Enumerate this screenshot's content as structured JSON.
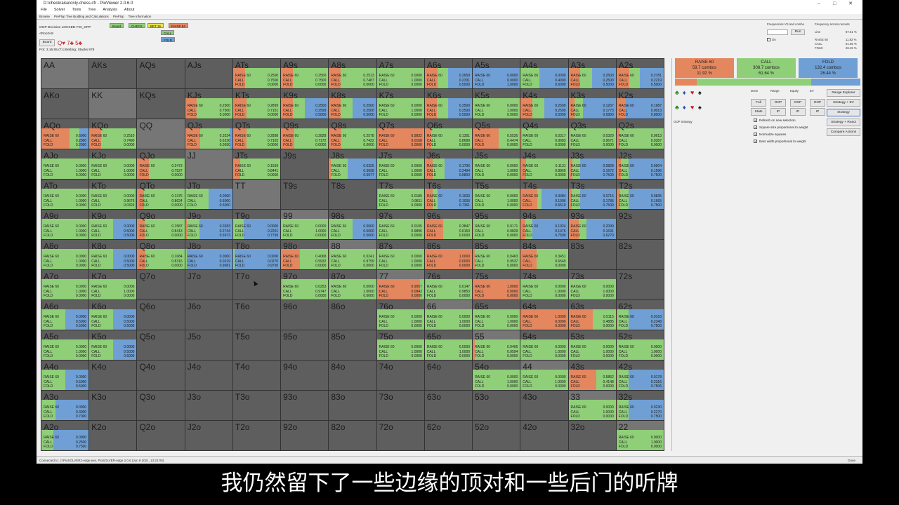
{
  "window": {
    "path": "D:\\checkraise\\only-chess.cfr - PioViewer 2.0.6.0",
    "controls": "–  □  ✕"
  },
  "menu": [
    "File",
    "Solver",
    "Tools",
    "Tree",
    "Analysis",
    "About"
  ],
  "tabs": [
    "Browse",
    "PreFlop Tree Building and Calculations",
    "PreFlop",
    "Tree Information"
  ],
  "toolbar": {
    "decision": "OOP Decision   LOCKED FIO_OPP",
    "root": "<Root>/8",
    "board_label": "Board",
    "pot_info": "Pot: 3.16.55 (7) | Betting: Stacks 978",
    "actions": [
      {
        "label": "Board",
        "color": "#8fcf78"
      },
      {
        "label": "CHECK",
        "color": "#8fcf78"
      },
      {
        "label": "BET 16",
        "color": "#e6e24a"
      },
      {
        "label": "RAISE 84",
        "color": "#e4875e"
      }
    ],
    "call_chip": "CALL",
    "fold_chip": "FOLD",
    "freq_header": "Frequencies VS and combo",
    "freq_across": "Frequency across runouts",
    "run_button": "Run",
    "line_label": "Line",
    "line_value": "87.61 %",
    "freq_rows": [
      [
        "RAISE 60",
        "11.92 %"
      ],
      [
        "CALL",
        "61.65 %"
      ],
      [
        "FOLD",
        "26.45 %"
      ]
    ],
    "on_label": "On"
  },
  "actions": [
    {
      "name": "RAISE 60",
      "combos": "59.7 combos",
      "pct": "11.92 %",
      "color": "#e4875e",
      "freq": 0.1192
    },
    {
      "name": "CALL",
      "combos": "308.7 combos",
      "pct": "61.64 %",
      "color": "#8fcf78",
      "freq": 0.6164
    },
    {
      "name": "FOLD",
      "combos": "132.4 combos",
      "pct": "26.44 %",
      "color": "#6f9fd4",
      "freq": 0.2644
    }
  ],
  "side": {
    "suits": [
      "♣",
      "♦",
      "♥",
      "♠"
    ],
    "suit_colors": [
      "#2a8a2a",
      "#2249b8",
      "#c42020",
      "#111111"
    ],
    "col_headers": [
      "Done",
      "Range",
      "Equity",
      "EV"
    ],
    "row1": [
      "Full",
      "OOP",
      "OOP",
      "OOP"
    ],
    "row2": [
      "Stats",
      "IP",
      "IP",
      "IP"
    ],
    "right_buttons": [
      "Range Explorer",
      "Strategy + EV",
      "Strategy",
      "Strategy + React",
      "Compare Actions"
    ],
    "oop_strategy": "OOP Strategy",
    "checks": [
      "Refresh on new selection",
      "Square size proportional to weight",
      "Normalize squares",
      "Bars width proportional to weight"
    ]
  },
  "status": {
    "left": "Connected to: J:\\PioSOLVER2-edge.exe, PioSOLVER-edge 2.0.6 (Jun 9 2021, 13:24:00)",
    "right": "Done"
  },
  "subtitle": "我仍然留下了一些边缘的顶对和一些后门的听牌",
  "matrix": [
    [
      "AA",
      "g",
      0,
      0,
      0
    ],
    [
      "AKs",
      "g",
      0,
      0,
      0
    ],
    [
      "AQs",
      "g",
      0,
      0,
      0
    ],
    [
      "AJs",
      "g",
      0,
      0,
      0
    ],
    [
      "ATs",
      "d",
      0.25,
      0.75,
      0
    ],
    [
      "A9s",
      "d",
      0.25,
      0.75,
      0
    ],
    [
      "A8s",
      "d",
      0.2513,
      0.7487,
      0
    ],
    [
      "A7s",
      "d",
      0,
      1,
      0
    ],
    [
      "A6s",
      "d",
      0.2659,
      0.2331,
      0.5
    ],
    [
      "A5s",
      "d",
      0,
      0,
      1
    ],
    [
      "A4s",
      "d",
      0,
      0.4,
      0.6
    ],
    [
      "A3s",
      "d",
      0.25,
      0.25,
      0.5
    ],
    [
      "A2s",
      "d",
      0.2781,
      0.2219,
      0.5
    ],
    [
      "AKo",
      "g",
      0,
      0,
      0
    ],
    [
      "KK",
      "g",
      0,
      0,
      0
    ],
    [
      "KQs",
      "g",
      0,
      0,
      0
    ],
    [
      "KJs",
      "d",
      0.25,
      0.75,
      0
    ],
    [
      "KTs",
      "d",
      0.2899,
      0.7101,
      0
    ],
    [
      "K9s",
      "d",
      0.25,
      0.2599,
      0.5
    ],
    [
      "K8s",
      "d",
      0.25,
      0.25,
      0.5
    ],
    [
      "K7s",
      "d",
      0,
      1,
      0
    ],
    [
      "K6s",
      "d",
      0.25,
      0.25,
      0.5
    ],
    [
      "K5s",
      "d",
      0,
      1,
      0
    ],
    [
      "K4s",
      "d",
      0.25,
      0.25,
      0.5
    ],
    [
      "K3s",
      "d",
      0.1267,
      0.1773,
      0.696
    ],
    [
      "K2s",
      "d",
      0.1987,
      0.0013,
      0.8
    ],
    [
      "AQo",
      "d",
      0.6,
      0.2,
      0.2
    ],
    [
      "KQo",
      "d",
      0.251,
      0.749,
      0
    ],
    [
      "QQ",
      "g",
      0,
      0,
      0
    ],
    [
      "QJs",
      "d",
      0.3224,
      0.6226,
      0.055
    ],
    [
      "QTs",
      "d",
      0.2898,
      0.7102,
      0
    ],
    [
      "Q9s",
      "d",
      0.2828,
      0.7172,
      0
    ],
    [
      "Q8s",
      "d",
      0.2578,
      0.7422,
      0
    ],
    [
      "Q7s",
      "d",
      0.9832,
      0.0168,
      0
    ],
    [
      "Q6s",
      "d",
      0.1301,
      0.8699,
      0
    ],
    [
      "Q5s",
      "d",
      0.5526,
      0.4474,
      0
    ],
    [
      "Q4s",
      "d",
      0.0317,
      0.9683,
      0
    ],
    [
      "Q3s",
      "d",
      0.0329,
      0.9671,
      0
    ],
    [
      "Q2s",
      "d",
      0.0613,
      0.9387,
      0
    ],
    [
      "AJo",
      "d",
      0,
      1,
      0
    ],
    [
      "KJo",
      "d",
      0,
      1,
      0
    ],
    [
      "QJo",
      "d",
      0.2473,
      0.7527,
      0
    ],
    [
      "JJ",
      "g",
      0,
      0,
      0
    ],
    [
      "JTs",
      "d",
      0.1559,
      0.8441,
      0
    ],
    [
      "J9s",
      "g",
      0,
      0,
      0
    ],
    [
      "J8s",
      "d",
      0.0325,
      0.3698,
      0.5977
    ],
    [
      "J7s",
      "d",
      0,
      1,
      0
    ],
    [
      "J6s",
      "d",
      0.1706,
      0.2494,
      0.58
    ],
    [
      "J5s",
      "d",
      0,
      1,
      0
    ],
    [
      "J4s",
      "d",
      0.1131,
      0.8869,
      0
    ],
    [
      "J3s",
      "d",
      0.0828,
      0.1672,
      0.75
    ],
    [
      "J2s",
      "d",
      0.0904,
      0.1596,
      0.75
    ],
    [
      "ATo",
      "d",
      0,
      1,
      0
    ],
    [
      "KTo",
      "d",
      0,
      0.9676,
      0.0324
    ],
    [
      "QTo",
      "d",
      0.1376,
      0.8624,
      0
    ],
    [
      "JTo",
      "d",
      0,
      0.5,
      0.5
    ],
    [
      "TT",
      "g",
      0,
      0,
      0
    ],
    [
      "T9s",
      "g",
      0,
      0,
      0
    ],
    [
      "T8s",
      "g",
      0,
      0,
      0
    ],
    [
      "T7s",
      "d",
      0.0189,
      0.9811,
      0
    ],
    [
      "T6s",
      "d",
      0.1633,
      0.1006,
      0.7361
    ],
    [
      "T5s",
      "d",
      0,
      1,
      0
    ],
    [
      "T4s",
      "d",
      0.3484,
      0.1006,
      0.551
    ],
    [
      "T3s",
      "d",
      0.0715,
      0.1785,
      0.75
    ],
    [
      "T2s",
      "d",
      0.0835,
      0.1665,
      0.75
    ],
    [
      "A9o",
      "d",
      0,
      1,
      0
    ],
    [
      "K9o",
      "d",
      0,
      0.5,
      0.5
    ],
    [
      "Q9o",
      "d",
      0.1587,
      0.8413,
      0
    ],
    [
      "J9o",
      "d",
      0.0283,
      0.2744,
      0.6973
    ],
    [
      "T9o",
      "d",
      0,
      0.2201,
      0.7799
    ],
    [
      "99",
      "d",
      0,
      1,
      0
    ],
    [
      "98s",
      "d",
      0,
      0.5,
      0.5
    ],
    [
      "97s",
      "d",
      0.0105,
      0.9895,
      0
    ],
    [
      "96s",
      "d",
      0.3847,
      0.6153,
      0
    ],
    [
      "95s",
      "d",
      0.0171,
      0.9829,
      0
    ],
    [
      "94s",
      "d",
      0.1024,
      0.1476,
      0.75
    ],
    [
      "93s",
      "d",
      0.2099,
      0.1631,
      0.627
    ],
    [
      "92s",
      "g",
      0,
      0,
      0
    ],
    [
      "A8o",
      "d",
      0,
      1,
      0
    ],
    [
      "K8o",
      "d",
      0,
      0.5,
      0.5
    ],
    [
      "Q8o",
      "d",
      0.1684,
      0.8316,
      0
    ],
    [
      "J8o",
      "d",
      0,
      0.0319,
      0.9681
    ],
    [
      "T8o",
      "d",
      0,
      0.027,
      0.973
    ],
    [
      "98o",
      "d",
      0.4068,
      0.5932,
      0
    ],
    [
      "88",
      "d",
      0.0241,
      0.9759,
      0
    ],
    [
      "87s",
      "d",
      0,
      1,
      0
    ],
    [
      "86s",
      "d",
      1,
      0,
      0
    ],
    [
      "85s",
      "d",
      0.0463,
      0.9537,
      0
    ],
    [
      "84s",
      "d",
      0.3451,
      0.6549,
      0
    ],
    [
      "83s",
      "g",
      0,
      0,
      0
    ],
    [
      "82s",
      "g",
      0,
      0,
      0
    ],
    [
      "A7o",
      "d",
      0,
      1,
      0
    ],
    [
      "K7o",
      "d",
      0,
      1,
      0
    ],
    [
      "Q7o",
      "g",
      0,
      0,
      0
    ],
    [
      "J7o",
      "g",
      0,
      0,
      0
    ],
    [
      "T7o",
      "g",
      0,
      0,
      0
    ],
    [
      "97o",
      "d",
      0.0253,
      0.9747,
      0
    ],
    [
      "87o",
      "d",
      0,
      1,
      0
    ],
    [
      "77",
      "d",
      0.9057,
      0.0943,
      0
    ],
    [
      "76s",
      "d",
      0.0147,
      0.9853,
      0
    ],
    [
      "75s",
      "d",
      1,
      0,
      0
    ],
    [
      "74s",
      "d",
      0,
      1,
      0
    ],
    [
      "73s",
      "d",
      0,
      1,
      0
    ],
    [
      "72s",
      "g",
      0,
      0,
      0
    ],
    [
      "A6o",
      "d",
      0,
      0.5,
      0.5
    ],
    [
      "K6o",
      "d",
      0,
      0.5,
      0.5
    ],
    [
      "Q6o",
      "g",
      0,
      0,
      0
    ],
    [
      "J6o",
      "g",
      0,
      0,
      0
    ],
    [
      "T6o",
      "g",
      0,
      0,
      0
    ],
    [
      "96o",
      "g",
      0,
      0,
      0
    ],
    [
      "86o",
      "g",
      0,
      0,
      0
    ],
    [
      "76o",
      "d",
      0,
      1,
      0
    ],
    [
      "66",
      "d",
      0,
      1,
      0
    ],
    [
      "65s",
      "d",
      0,
      1,
      0
    ],
    [
      "64s",
      "d",
      1,
      0,
      0
    ],
    [
      "63s",
      "d",
      0.5115,
      0.4885,
      0
    ],
    [
      "62s",
      "d",
      0.0163,
      0.2348,
      0.75
    ],
    [
      "A5o",
      "d",
      0,
      1,
      0
    ],
    [
      "K5o",
      "d",
      0,
      0.5,
      0.5
    ],
    [
      "Q5o",
      "g",
      0,
      0,
      0
    ],
    [
      "J5o",
      "g",
      0,
      0,
      0
    ],
    [
      "T5o",
      "g",
      0,
      0,
      0
    ],
    [
      "95o",
      "g",
      0,
      0,
      0
    ],
    [
      "85o",
      "g",
      0,
      0,
      0
    ],
    [
      "75o",
      "d",
      0,
      1,
      0
    ],
    [
      "65o",
      "d",
      0,
      1,
      0
    ],
    [
      "55",
      "d",
      0.0406,
      0.9594,
      0
    ],
    [
      "54s",
      "d",
      0,
      1,
      0
    ],
    [
      "53s",
      "d",
      0,
      1,
      0
    ],
    [
      "52s",
      "d",
      0,
      1,
      0
    ],
    [
      "A4o",
      "d",
      0,
      0.5,
      0.5
    ],
    [
      "K4o",
      "g",
      0,
      0,
      0
    ],
    [
      "Q4o",
      "g",
      0,
      0,
      0
    ],
    [
      "J4o",
      "g",
      0,
      0,
      0
    ],
    [
      "T4o",
      "g",
      0,
      0,
      0
    ],
    [
      "94o",
      "g",
      0,
      0,
      0
    ],
    [
      "84o",
      "g",
      0,
      0,
      0
    ],
    [
      "74o",
      "g",
      0,
      0,
      0
    ],
    [
      "64o",
      "g",
      0,
      0,
      0
    ],
    [
      "54o",
      "d",
      0,
      1,
      0
    ],
    [
      "44",
      "d",
      0,
      1,
      0
    ],
    [
      "43s",
      "d",
      0.5852,
      0.4148,
      0
    ],
    [
      "42s",
      "d",
      0.0178,
      0.2316,
      0.7506
    ],
    [
      "A3o",
      "d",
      0,
      0.3,
      0.7
    ],
    [
      "K3o",
      "g",
      0,
      0,
      0
    ],
    [
      "Q3o",
      "g",
      0,
      0,
      0
    ],
    [
      "J3o",
      "g",
      0,
      0,
      0
    ],
    [
      "T3o",
      "g",
      0,
      0,
      0
    ],
    [
      "93o",
      "g",
      0,
      0,
      0
    ],
    [
      "83o",
      "g",
      0,
      0,
      0
    ],
    [
      "73o",
      "g",
      0,
      0,
      0
    ],
    [
      "63o",
      "g",
      0,
      0,
      0
    ],
    [
      "53o",
      "g",
      0,
      0,
      0
    ],
    [
      "43o",
      "g",
      0,
      0,
      0
    ],
    [
      "33",
      "d",
      0,
      1,
      0
    ],
    [
      "32s",
      "d",
      0.023,
      0.227,
      0.75
    ],
    [
      "A2o",
      "d",
      0,
      0.25,
      0.75
    ],
    [
      "K2o",
      "g",
      0,
      0,
      0
    ],
    [
      "Q2o",
      "g",
      0,
      0,
      0
    ],
    [
      "J2o",
      "g",
      0,
      0,
      0
    ],
    [
      "T2o",
      "g",
      0,
      0,
      0
    ],
    [
      "92o",
      "g",
      0,
      0,
      0
    ],
    [
      "82o",
      "g",
      0,
      0,
      0
    ],
    [
      "72o",
      "g",
      0,
      0,
      0
    ],
    [
      "62o",
      "g",
      0,
      0,
      0
    ],
    [
      "52o",
      "g",
      0,
      0,
      0
    ],
    [
      "42o",
      "g",
      0,
      0,
      0
    ],
    [
      "32o",
      "g",
      0,
      0,
      0
    ],
    [
      "22",
      "d",
      0,
      1,
      0
    ]
  ]
}
